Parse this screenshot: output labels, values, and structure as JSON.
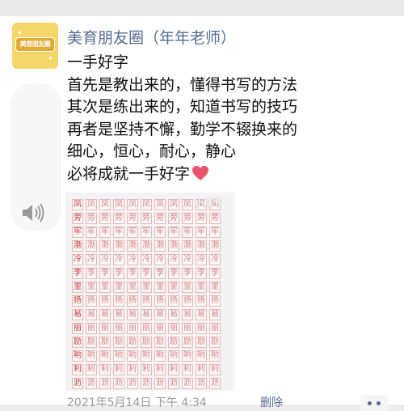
{
  "post": {
    "author_name": "美育朋友圈（年年老师）",
    "avatar_text": "美育朋友圈",
    "lines": [
      "一手好字",
      "首先是教出来的，懂得书写的方法",
      "其次是练出来的，知道书写的技巧",
      "再者是坚持不懈，勤学不辍换来的",
      "细心，恒心，耐心，静心",
      "必将成就一手好字"
    ],
    "photo_watermark": "小红书",
    "timestamp": "2021年5月14日 下午 4:34",
    "delete_label": "删除"
  },
  "photo_grid": {
    "rows": [
      "凤",
      "旁",
      "牢",
      "渤",
      "冷",
      "李",
      "里",
      "扬",
      "易",
      "丽",
      "励",
      "哟",
      "利",
      "沥"
    ]
  },
  "colors": {
    "link": "#576b95",
    "heart": "#e8546d",
    "ink": "#c23a3a"
  },
  "icons": {
    "voice": "speaker-icon",
    "like": "heart-icon",
    "more": "more-dots-icon"
  }
}
